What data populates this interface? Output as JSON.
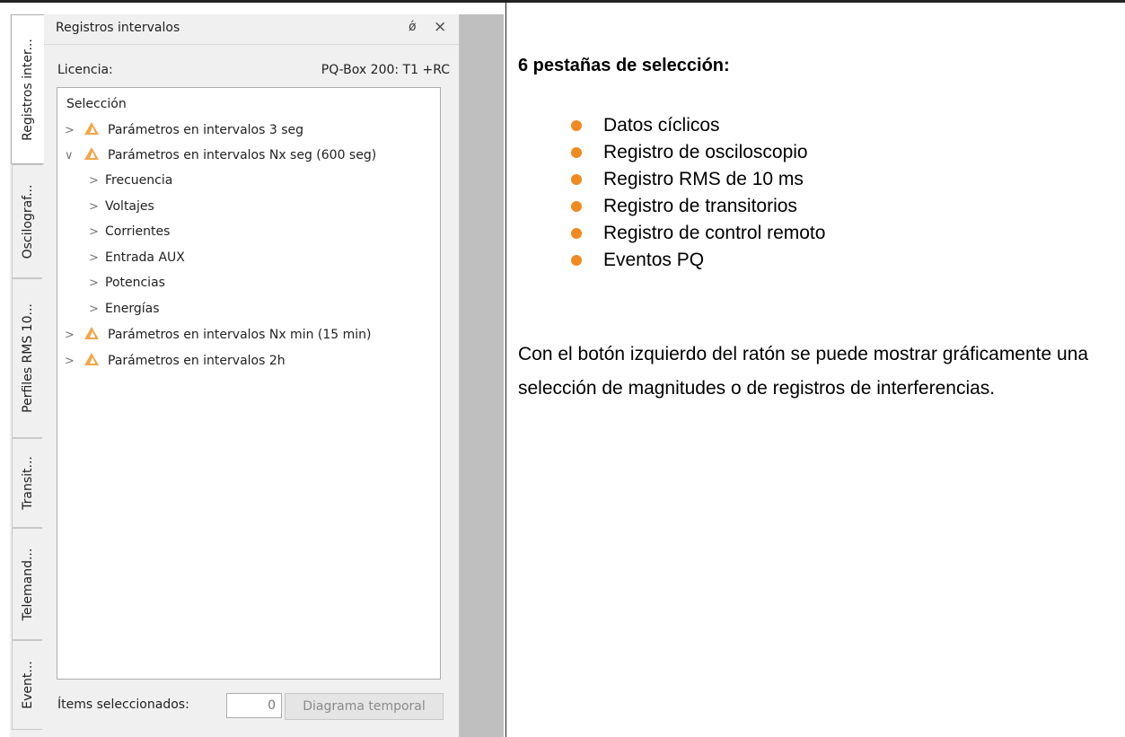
{
  "side_tabs": [
    {
      "label": "Registros inter...",
      "active": true
    },
    {
      "label": "Oscilograf...",
      "active": false
    },
    {
      "label": "Perfiles RMS 10...",
      "active": false
    },
    {
      "label": "Transit...",
      "active": false
    },
    {
      "label": "Telemand...",
      "active": false
    },
    {
      "label": "Event...",
      "active": false
    }
  ],
  "pane": {
    "title": "Registros intervalos",
    "float_glyph": "ǿ",
    "close_glyph": "×",
    "license_label": "Licencia:",
    "license_value": "PQ-Box 200: T1 +RC",
    "tree_root": "Selección",
    "tree": [
      {
        "label": "Parámetros en intervalos 3 seg",
        "chevron": ">",
        "icon": true
      },
      {
        "label": "Parámetros en intervalos Nx seg (600 seg)",
        "chevron": "∨",
        "icon": true
      },
      {
        "label": "Frecuencia",
        "chevron": ">",
        "icon": false
      },
      {
        "label": "Voltajes",
        "chevron": ">",
        "icon": false
      },
      {
        "label": "Corrientes",
        "chevron": ">",
        "icon": false
      },
      {
        "label": "Entrada AUX",
        "chevron": ">",
        "icon": false
      },
      {
        "label": "Potencias",
        "chevron": ">",
        "icon": false
      },
      {
        "label": "Energías",
        "chevron": ">",
        "icon": false
      },
      {
        "label": "Parámetros en intervalos Nx min (15 min)",
        "chevron": ">",
        "icon": true
      },
      {
        "label": "Parámetros en intervalos 2h",
        "chevron": ">",
        "icon": true
      }
    ],
    "selected_label": "Ítems seleccionados:",
    "selected_count": "0",
    "diagram_button": "Diagrama temporal"
  },
  "doc": {
    "heading": "6 pestañas de selección:",
    "bullets": [
      "Datos cíclicos",
      "Registro de osciloscopio",
      "Registro RMS de 10 ms",
      "Registro de transitorios",
      "Registro de control remoto",
      "Eventos PQ"
    ],
    "paragraph": "Con el botón izquierdo del ratón se puede mostrar gráficamente una selección de magnitudes o de registros de interferencias.",
    "bullet_color": "#f08a20",
    "icon_color": "#f2a64a"
  }
}
